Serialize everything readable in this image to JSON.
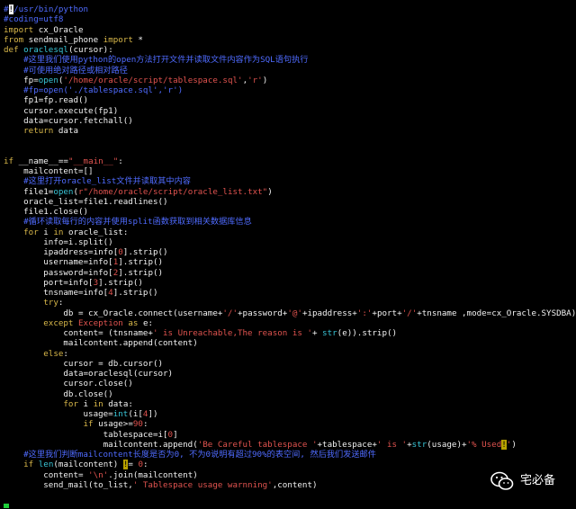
{
  "colors": {
    "comment": "#4f6bff",
    "keyword": "#d9b84a",
    "builtin": "#39c4d6",
    "string": "#e0534f",
    "text": "#f2f2f2",
    "background": "#000000"
  },
  "lines": [
    [
      [
        "#",
        "blue"
      ],
      [
        "!",
        "cursor"
      ],
      [
        "/usr/bin/python",
        "blue"
      ]
    ],
    [
      [
        "#coding=utf8",
        "blue"
      ]
    ],
    [
      [
        "import",
        "kw"
      ],
      [
        " cx_Oracle",
        "white"
      ]
    ],
    [
      [
        "from",
        "kw"
      ],
      [
        " sendmail_phone ",
        "white"
      ],
      [
        "import",
        "kw"
      ],
      [
        " *",
        "white"
      ]
    ],
    [
      [
        "def",
        "kw"
      ],
      [
        " oraclesql",
        "cyan"
      ],
      [
        "(cursor):",
        "white"
      ]
    ],
    [
      [
        "    #这里我们使用python的open方法打开文件并读取文件内容作为SQL语句执行",
        "blue"
      ]
    ],
    [
      [
        "    #可使用绝对路径或相对路径",
        "blue"
      ]
    ],
    [
      [
        "    fp=",
        "white"
      ],
      [
        "open",
        "cyan"
      ],
      [
        "(",
        "white"
      ],
      [
        "'/home/oracle/script/tablespace.sql'",
        "str"
      ],
      [
        ",",
        "white"
      ],
      [
        "'r'",
        "str"
      ],
      [
        ")",
        "white"
      ]
    ],
    [
      [
        "    #fp=open('./tablespace.sql','r')",
        "blue"
      ]
    ],
    [
      [
        "    fp1=fp.read()",
        "white"
      ]
    ],
    [
      [
        "    cursor.execute(fp1)",
        "white"
      ]
    ],
    [
      [
        "    data=cursor.fetchall()",
        "white"
      ]
    ],
    [
      [
        "    ",
        "white"
      ],
      [
        "return",
        "kw"
      ],
      [
        " data",
        "white"
      ]
    ],
    [
      [
        "",
        "white"
      ]
    ],
    [
      [
        "",
        "white"
      ]
    ],
    [
      [
        "if",
        "kw"
      ],
      [
        " __name__==",
        "white"
      ],
      [
        "\"__main__\"",
        "str"
      ],
      [
        ":",
        "white"
      ]
    ],
    [
      [
        "    mailcontent=[]",
        "white"
      ]
    ],
    [
      [
        "    #这里打开oracle_list文件并读取其中内容",
        "blue"
      ]
    ],
    [
      [
        "    file1=",
        "white"
      ],
      [
        "open",
        "cyan"
      ],
      [
        "(",
        "white"
      ],
      [
        "r\"/home/oracle/script/oracle_list.txt\"",
        "str"
      ],
      [
        ")",
        "white"
      ]
    ],
    [
      [
        "    oracle_list=file1.readlines()",
        "white"
      ]
    ],
    [
      [
        "    file1.close()",
        "white"
      ]
    ],
    [
      [
        "    #循环读取每行的内容并使用split函数获取到相关数据库信息",
        "blue"
      ]
    ],
    [
      [
        "    ",
        "white"
      ],
      [
        "for",
        "kw"
      ],
      [
        " i ",
        "white"
      ],
      [
        "in",
        "kw"
      ],
      [
        " oracle_list:",
        "white"
      ]
    ],
    [
      [
        "        info=i.split()",
        "white"
      ]
    ],
    [
      [
        "        ipaddress=info[",
        "white"
      ],
      [
        "0",
        "str"
      ],
      [
        "].strip()",
        "white"
      ]
    ],
    [
      [
        "        username=info[",
        "white"
      ],
      [
        "1",
        "str"
      ],
      [
        "].strip()",
        "white"
      ]
    ],
    [
      [
        "        password=info[",
        "white"
      ],
      [
        "2",
        "str"
      ],
      [
        "].strip()",
        "white"
      ]
    ],
    [
      [
        "        port=info[",
        "white"
      ],
      [
        "3",
        "str"
      ],
      [
        "].strip()",
        "white"
      ]
    ],
    [
      [
        "        tnsname=info[",
        "white"
      ],
      [
        "4",
        "str"
      ],
      [
        "].strip()",
        "white"
      ]
    ],
    [
      [
        "        ",
        "white"
      ],
      [
        "try",
        "kw"
      ],
      [
        ":",
        "white"
      ]
    ],
    [
      [
        "            db = cx_Oracle.connect(username+",
        "white"
      ],
      [
        "'/'",
        "str"
      ],
      [
        "+password+",
        "white"
      ],
      [
        "'@'",
        "str"
      ],
      [
        "+ipaddress+",
        "white"
      ],
      [
        "':'",
        "str"
      ],
      [
        "+port+",
        "white"
      ],
      [
        "'/'",
        "str"
      ],
      [
        "+tnsname ,mode=cx_Oracle.SYSDBA)",
        "white"
      ]
    ],
    [
      [
        "        ",
        "white"
      ],
      [
        "except",
        "kw"
      ],
      [
        " ",
        "white"
      ],
      [
        "Exception",
        "str"
      ],
      [
        " ",
        "white"
      ],
      [
        "as",
        "kw"
      ],
      [
        " e:",
        "white"
      ]
    ],
    [
      [
        "            content= (tnsname+",
        "white"
      ],
      [
        "' is Unreachable,The reason is '",
        "str"
      ],
      [
        "+ ",
        "white"
      ],
      [
        "str",
        "cyan"
      ],
      [
        "(e)).strip()",
        "white"
      ]
    ],
    [
      [
        "            mailcontent.append(content)",
        "white"
      ]
    ],
    [
      [
        "        ",
        "white"
      ],
      [
        "else",
        "kw"
      ],
      [
        ":",
        "white"
      ]
    ],
    [
      [
        "            cursor = db.cursor()",
        "white"
      ]
    ],
    [
      [
        "            data=oraclesql(cursor)",
        "white"
      ]
    ],
    [
      [
        "            cursor.close()",
        "white"
      ]
    ],
    [
      [
        "            db.close()",
        "white"
      ]
    ],
    [
      [
        "            ",
        "white"
      ],
      [
        "for",
        "kw"
      ],
      [
        " i ",
        "white"
      ],
      [
        "in",
        "kw"
      ],
      [
        " data:",
        "white"
      ]
    ],
    [
      [
        "                usage=",
        "white"
      ],
      [
        "int",
        "cyan"
      ],
      [
        "(i[",
        "white"
      ],
      [
        "4",
        "str"
      ],
      [
        "])",
        "white"
      ]
    ],
    [
      [
        "                ",
        "white"
      ],
      [
        "if",
        "kw"
      ],
      [
        " usage>=",
        "white"
      ],
      [
        "90",
        "str"
      ],
      [
        ":",
        "white"
      ]
    ],
    [
      [
        "                    tablespace=i[",
        "white"
      ],
      [
        "0",
        "str"
      ],
      [
        "]",
        "white"
      ]
    ],
    [
      [
        "                    mailcontent.append(",
        "white"
      ],
      [
        "'Be Careful tablespace '",
        "str"
      ],
      [
        "+tablespace+",
        "white"
      ],
      [
        "' is '",
        "str"
      ],
      [
        "+",
        "white"
      ],
      [
        "str",
        "cyan"
      ],
      [
        "(usage)+",
        "white"
      ],
      [
        "'% Used",
        "str"
      ],
      [
        "!",
        "hl"
      ],
      [
        "'",
        "str"
      ],
      [
        ")",
        "white"
      ]
    ],
    [
      [
        "    #这里我们判断mailcontent长度是否为0, 不为0说明有超过90%的表空间, 然后我们发送邮件",
        "blue"
      ]
    ],
    [
      [
        "    ",
        "white"
      ],
      [
        "if",
        "kw"
      ],
      [
        " ",
        "white"
      ],
      [
        "len",
        "cyan"
      ],
      [
        "(mailcontent) ",
        "white"
      ],
      [
        "!",
        "hl"
      ],
      [
        "= ",
        "white"
      ],
      [
        "0",
        "str"
      ],
      [
        ":",
        "white"
      ]
    ],
    [
      [
        "        content= ",
        "white"
      ],
      [
        "'\\n'",
        "str"
      ],
      [
        ".join(mailcontent)",
        "white"
      ]
    ],
    [
      [
        "        send_mail(to_list,",
        "white"
      ],
      [
        "' Tablespace usage warnning'",
        "str"
      ],
      [
        ",content)",
        "white"
      ]
    ]
  ],
  "watermark": {
    "text": "宅必备"
  }
}
